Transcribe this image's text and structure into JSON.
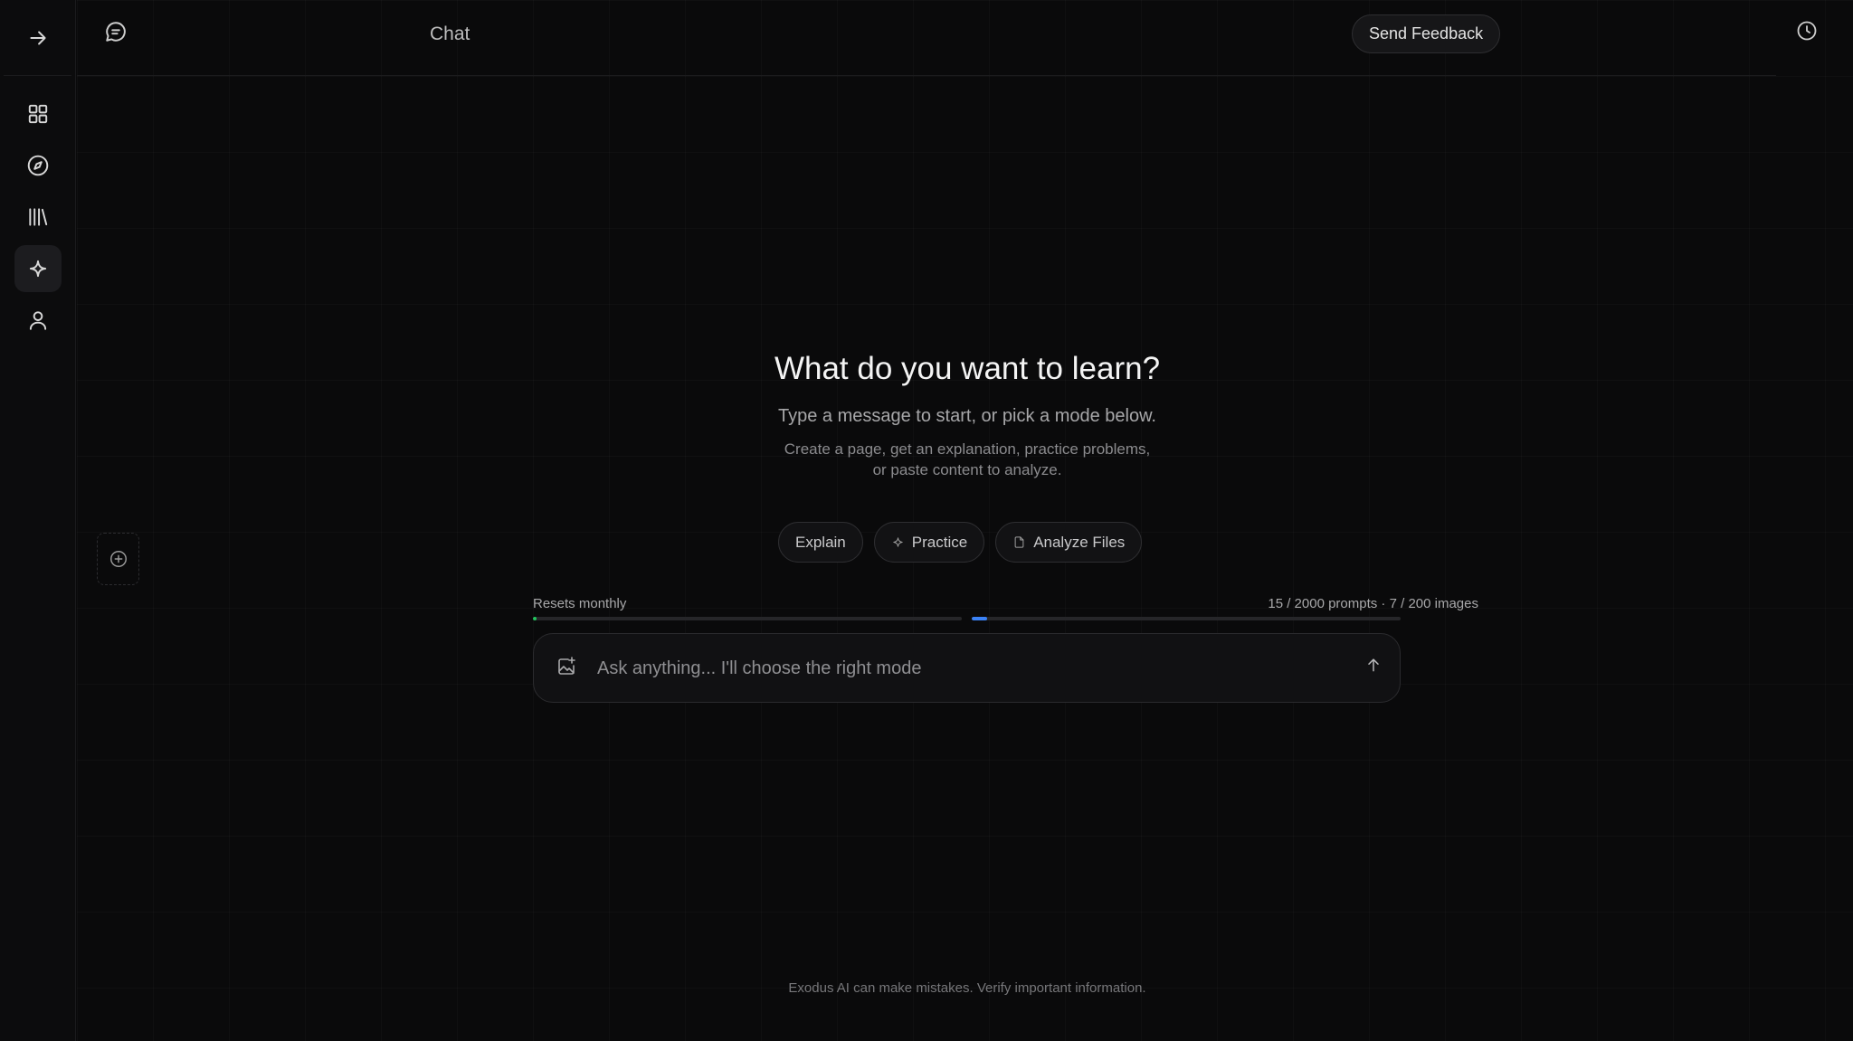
{
  "sidebar": {
    "toggle_icon": "arrow-right-icon",
    "items": [
      {
        "name": "dashboard",
        "icon": "grid-icon",
        "active": false
      },
      {
        "name": "explore",
        "icon": "compass-icon",
        "active": false
      },
      {
        "name": "library",
        "icon": "library-icon",
        "active": false
      },
      {
        "name": "ai-chat",
        "icon": "sparkle-icon",
        "active": true
      },
      {
        "name": "profile",
        "icon": "user-icon",
        "active": false
      }
    ]
  },
  "header": {
    "title": "Chat",
    "feedback_label": "Send Feedback"
  },
  "hero": {
    "title": "What do you want to learn?",
    "subtitle": "Type a message to start, or pick a mode below.",
    "description": "Create a page, get an explanation, practice problems, or paste content to analyze."
  },
  "modes": [
    {
      "label": "Explain",
      "icon": ""
    },
    {
      "label": "Practice",
      "icon": "sparkle-icon"
    },
    {
      "label": "Analyze Files",
      "icon": "file-icon"
    }
  ],
  "quota": {
    "reset_label": "Resets monthly",
    "usage_label": "15 / 2000 prompts · 7 / 200 images",
    "prompts_fraction": 0.0075,
    "images_fraction": 0.035,
    "prompts_color": "#22c55e",
    "images_color": "#3b82f6"
  },
  "input": {
    "placeholder": "Ask anything... I'll choose the right mode",
    "value": ""
  },
  "disclaimer": "Exodus AI can make mistakes. Verify important information."
}
